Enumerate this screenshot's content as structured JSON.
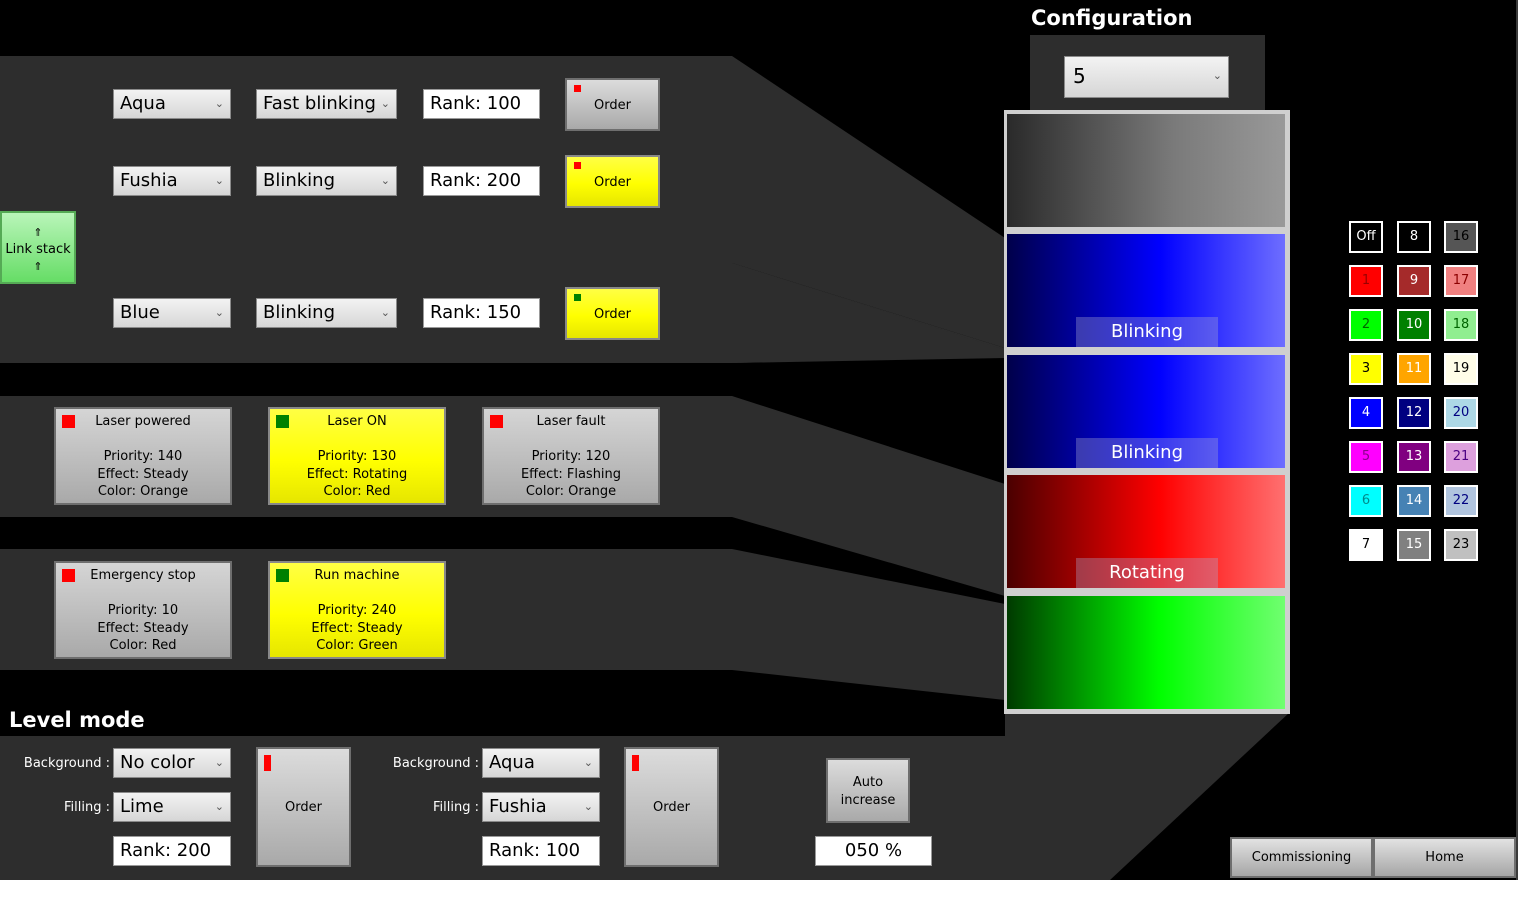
{
  "config": {
    "title": "Configuration",
    "count_value": "5"
  },
  "rows": [
    {
      "color": "Aqua",
      "effect": "Fast blinking",
      "rank": "Rank: 100",
      "order_label": "Order",
      "led_color": "#ff0000",
      "active": false
    },
    {
      "color": "Fushia",
      "effect": "Blinking",
      "rank": "Rank: 200",
      "order_label": "Order",
      "led_color": "#ff0000",
      "active": true
    },
    {
      "color": "Blue",
      "effect": "Blinking",
      "rank": "Rank: 150",
      "order_label": "Order",
      "led_color": "#008000",
      "active": true
    }
  ],
  "link_stack": {
    "arrow_up": "⇑",
    "label": "Link stack",
    "arrow_down": "⇑"
  },
  "cards": [
    {
      "title": "Laser powered",
      "priority": "Priority: 140",
      "effect": "Effect: Steady",
      "color": "Color: Orange",
      "square": "#ff0000",
      "active": false
    },
    {
      "title": "Laser ON",
      "priority": "Priority: 130",
      "effect": "Effect: Rotating",
      "color": "Color: Red",
      "square": "#008000",
      "active": true
    },
    {
      "title": "Laser fault",
      "priority": "Priority: 120",
      "effect": "Effect: Flashing",
      "color": "Color: Orange",
      "square": "#ff0000",
      "active": false
    },
    {
      "title": "Emergency stop",
      "priority": "Priority: 10",
      "effect": "Effect: Steady",
      "color": "Color: Red",
      "square": "#ff0000",
      "active": false
    },
    {
      "title": "Run machine",
      "priority": "Priority: 240",
      "effect": "Effect: Steady",
      "color": "Color: Green",
      "square": "#008000",
      "active": true
    }
  ],
  "stack": {
    "labels": [
      "",
      "Blinking",
      "Blinking",
      "Rotating",
      ""
    ]
  },
  "palette": [
    {
      "label": "Off",
      "bg": "#000000",
      "fg": "#ffffff"
    },
    {
      "label": "8",
      "bg": "#000000",
      "fg": "#ffffff"
    },
    {
      "label": "16",
      "bg": "#555555",
      "fg": "#000000"
    },
    {
      "label": "1",
      "bg": "#ff0000",
      "fg": "#990000"
    },
    {
      "label": "9",
      "bg": "#a52a2a",
      "fg": "#ffffff"
    },
    {
      "label": "17",
      "bg": "#f08080",
      "fg": "#8b0000"
    },
    {
      "label": "2",
      "bg": "#00ff00",
      "fg": "#006400"
    },
    {
      "label": "10",
      "bg": "#008000",
      "fg": "#ffffff"
    },
    {
      "label": "18",
      "bg": "#90ee90",
      "fg": "#006400"
    },
    {
      "label": "3",
      "bg": "#ffff00",
      "fg": "#000000"
    },
    {
      "label": "11",
      "bg": "#ffa500",
      "fg": "#ffffff"
    },
    {
      "label": "19",
      "bg": "#fffde8",
      "fg": "#000000"
    },
    {
      "label": "4",
      "bg": "#0000ff",
      "fg": "#ffffff"
    },
    {
      "label": "12",
      "bg": "#000080",
      "fg": "#ffffff"
    },
    {
      "label": "20",
      "bg": "#add8e6",
      "fg": "#000080"
    },
    {
      "label": "5",
      "bg": "#ff00ff",
      "fg": "#8b008b"
    },
    {
      "label": "13",
      "bg": "#800080",
      "fg": "#ffffff"
    },
    {
      "label": "21",
      "bg": "#dda0dd",
      "fg": "#4b0082"
    },
    {
      "label": "6",
      "bg": "#00ffff",
      "fg": "#008b8b"
    },
    {
      "label": "14",
      "bg": "#4682b4",
      "fg": "#ffffff"
    },
    {
      "label": "22",
      "bg": "#b0c4de",
      "fg": "#000080"
    },
    {
      "label": "7",
      "bg": "#ffffff",
      "fg": "#000000"
    },
    {
      "label": "15",
      "bg": "#808080",
      "fg": "#ffffff"
    },
    {
      "label": "23",
      "bg": "#c0c0c0",
      "fg": "#000000"
    }
  ],
  "level_mode": {
    "title": "Level mode",
    "background_label": "Background :",
    "filling_label": "Filling :",
    "left": {
      "background": "No color",
      "filling": "Lime",
      "rank": "Rank: 200",
      "order_label": "Order",
      "led_color": "#ff0000"
    },
    "right": {
      "background": "Aqua",
      "filling": "Fushia",
      "rank": "Rank: 100",
      "order_label": "Order",
      "led_color": "#ff0000"
    },
    "auto_label_1": "Auto",
    "auto_label_2": "increase",
    "percent": "050 %"
  },
  "nav": {
    "commissioning": "Commissioning",
    "home": "Home"
  }
}
